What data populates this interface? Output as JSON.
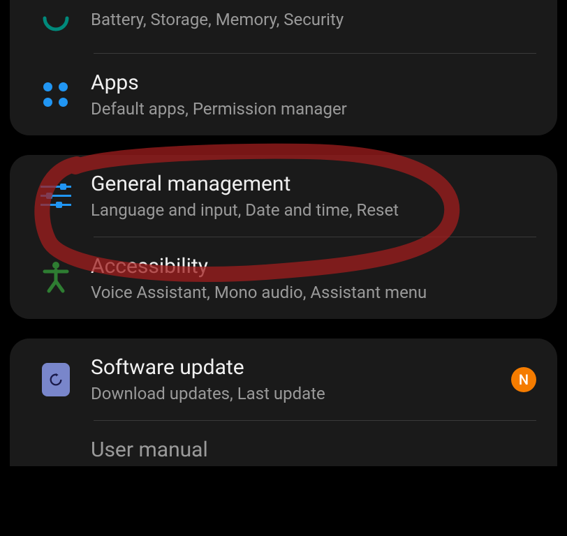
{
  "group1": {
    "device_care": {
      "sub": "Battery, Storage, Memory, Security"
    },
    "apps": {
      "title": "Apps",
      "sub": "Default apps, Permission manager"
    }
  },
  "group2": {
    "general": {
      "title": "General management",
      "sub": "Language and input, Date and time, Reset"
    },
    "accessibility": {
      "title": "Accessibility",
      "sub": "Voice Assistant, Mono audio, Assistant menu"
    }
  },
  "group3": {
    "software_update": {
      "title": "Software update",
      "sub": "Download updates, Last update",
      "badge": "N"
    },
    "user_manual": {
      "title": "User manual"
    }
  }
}
